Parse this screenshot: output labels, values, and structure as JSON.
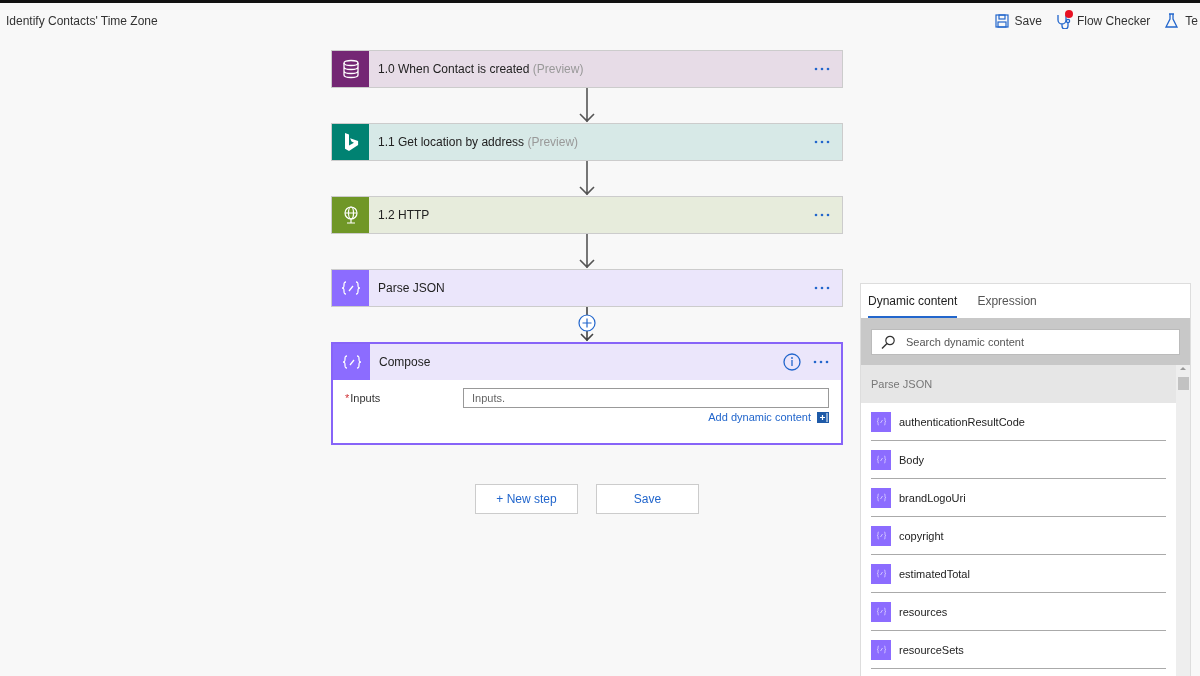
{
  "header": {
    "title": "Identify Contacts' Time Zone",
    "actions": [
      {
        "kind": "save",
        "label": "Save"
      },
      {
        "kind": "checker",
        "label": "Flow Checker",
        "has_issues": true
      },
      {
        "kind": "test",
        "label": "Te"
      }
    ]
  },
  "steps": [
    {
      "kind": "trigger",
      "title": "1.0 When Contact is created",
      "suffix": "(Preview)",
      "color": "#742774",
      "selected": false
    },
    {
      "kind": "location",
      "title": "1.1 Get location by address",
      "suffix": "(Preview)",
      "color": "#008272",
      "selected": false
    },
    {
      "kind": "http",
      "title": "1.2 HTTP",
      "color": "#709727",
      "selected": false
    },
    {
      "kind": "parse",
      "title": "Parse JSON",
      "color": "#8c6cff",
      "selected": false
    },
    {
      "kind": "compose",
      "title": "Compose",
      "color": "#8c6cff",
      "selected": true,
      "field": {
        "marker": "*",
        "label": "Inputs",
        "placeholder": "Inputs."
      },
      "link": "Add dynamic content"
    }
  ],
  "buttons": [
    "+ New step",
    "Save"
  ],
  "panel": {
    "tabs": [
      {
        "label": "Dynamic content",
        "selected": true
      },
      {
        "label": "Expression",
        "selected": false
      }
    ],
    "search": {
      "placeholder": "Search dynamic content"
    },
    "section": "Parse JSON",
    "items": [
      "authenticationResultCode",
      "Body",
      "brandLogoUri",
      "copyright",
      "estimatedTotal",
      "resources",
      "resourceSets"
    ]
  }
}
